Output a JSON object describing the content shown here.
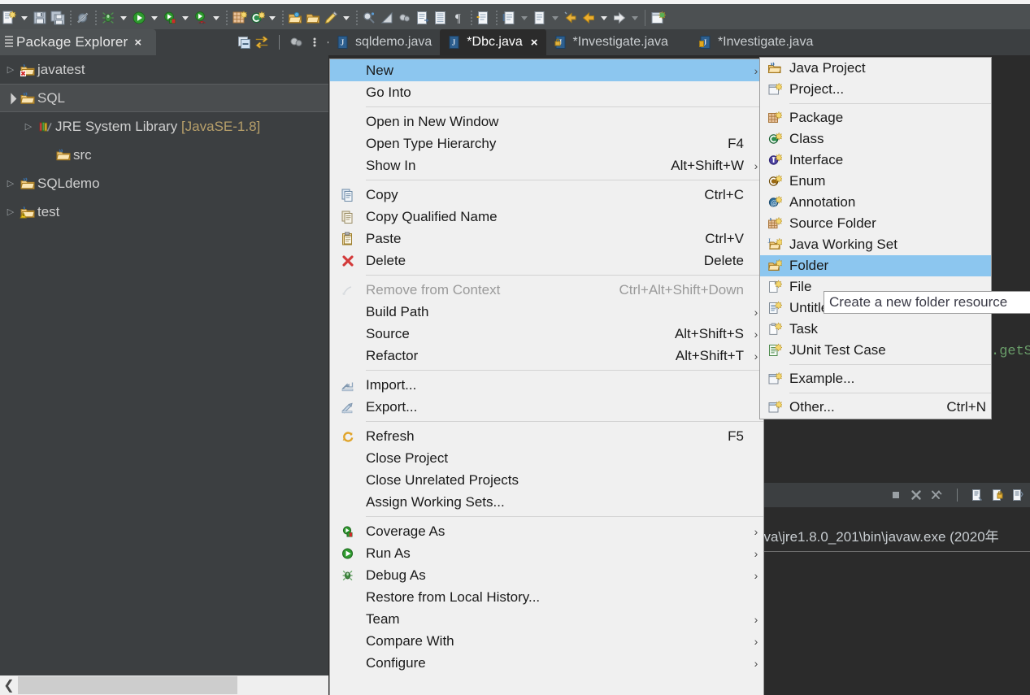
{
  "window": {
    "theme_background": "#3c3f41",
    "editor_background": "#2b2b2b",
    "menu_background": "#f0f0f0",
    "menu_highlight": "#8cc6ef"
  },
  "toolbar": {
    "items": [
      {
        "name": "new-wizard-icon",
        "type": "icon",
        "kind": "new-file"
      },
      {
        "name": "new-wizard-dropdown",
        "type": "arrow"
      },
      {
        "name": "save-icon",
        "type": "icon",
        "kind": "save"
      },
      {
        "name": "save-all-icon",
        "type": "icon",
        "kind": "save-all"
      },
      {
        "name": "toolbar-separator",
        "type": "sep"
      },
      {
        "name": "skip-all-breakpoints-icon",
        "type": "icon",
        "kind": "skip-breakpoints"
      },
      {
        "name": "toolbar-separator",
        "type": "sep"
      },
      {
        "name": "debug-icon",
        "type": "icon",
        "kind": "debug"
      },
      {
        "name": "debug-dropdown",
        "type": "arrow"
      },
      {
        "name": "run-icon",
        "type": "icon",
        "kind": "run"
      },
      {
        "name": "run-dropdown",
        "type": "arrow"
      },
      {
        "name": "coverage-icon",
        "type": "icon",
        "kind": "coverage"
      },
      {
        "name": "coverage-dropdown",
        "type": "arrow"
      },
      {
        "name": "profile-icon",
        "type": "icon",
        "kind": "profile"
      },
      {
        "name": "profile-dropdown",
        "type": "arrow"
      },
      {
        "name": "toolbar-separator",
        "type": "sep"
      },
      {
        "name": "new-package-icon",
        "type": "icon",
        "kind": "package"
      },
      {
        "name": "new-class-icon",
        "type": "icon",
        "kind": "class"
      },
      {
        "name": "new-class-dropdown",
        "type": "arrow"
      },
      {
        "name": "toolbar-separator",
        "type": "sep"
      },
      {
        "name": "open-type-icon",
        "type": "icon",
        "kind": "open-type"
      },
      {
        "name": "open-task-icon",
        "type": "icon",
        "kind": "open-folder"
      },
      {
        "name": "highlight-icon",
        "type": "icon",
        "kind": "pencil"
      },
      {
        "name": "highlight-dropdown",
        "type": "arrow"
      },
      {
        "name": "toolbar-separator",
        "type": "sep"
      },
      {
        "name": "search-icon",
        "type": "icon",
        "kind": "search"
      },
      {
        "name": "ruler-icon",
        "type": "icon",
        "kind": "ruler"
      },
      {
        "name": "link-icon",
        "type": "icon",
        "kind": "link"
      },
      {
        "name": "next-annotation-icon",
        "type": "icon",
        "kind": "annot1"
      },
      {
        "name": "prev-annotation-icon",
        "type": "icon",
        "kind": "annot2"
      },
      {
        "name": "show-whitespace-icon",
        "type": "icon",
        "kind": "pilcrow"
      },
      {
        "name": "toolbar-separator",
        "type": "sep"
      },
      {
        "name": "next-edit-icon",
        "type": "icon",
        "kind": "edit1"
      },
      {
        "name": "toolbar-separator",
        "type": "sep"
      },
      {
        "name": "prev-member-icon",
        "type": "icon",
        "kind": "member1"
      },
      {
        "name": "prev-member-dropdown",
        "type": "arrow",
        "dim": true
      },
      {
        "name": "next-member-icon",
        "type": "icon",
        "kind": "member2"
      },
      {
        "name": "next-member-dropdown",
        "type": "arrow",
        "dim": true
      },
      {
        "name": "back-history-icon",
        "type": "icon",
        "kind": "back-sm"
      },
      {
        "name": "back-icon",
        "type": "icon",
        "kind": "back"
      },
      {
        "name": "back-dropdown",
        "type": "arrow"
      },
      {
        "name": "forward-icon",
        "type": "icon",
        "kind": "forward"
      },
      {
        "name": "forward-dropdown",
        "type": "arrow",
        "dim": true
      },
      {
        "name": "toolbar-separator",
        "type": "sepsolid"
      },
      {
        "name": "new-java-project-icon",
        "type": "icon",
        "kind": "new-proj"
      }
    ]
  },
  "package_explorer": {
    "tab_title": "Package Explorer",
    "close_label": "×",
    "view_tools": [
      "collapse-all-icon",
      "link-with-editor-icon",
      "view-menu-icon",
      "minimize-icon",
      "maximize-icon"
    ],
    "tree": [
      {
        "label": "javatest",
        "indent": 0,
        "arrow": "collapsed",
        "icon": "java-project-error",
        "selected": false
      },
      {
        "label": "SQL",
        "indent": 0,
        "arrow": "expanded",
        "icon": "java-project",
        "selected": true
      },
      {
        "label": "JRE System Library ",
        "suffix": "[JavaSE-1.8]",
        "indent": 1,
        "arrow": "collapsed",
        "icon": "library",
        "selected": false
      },
      {
        "label": "src",
        "indent": 2,
        "arrow": "none",
        "icon": "source-folder",
        "selected": false
      },
      {
        "label": "SQLdemo",
        "indent": 0,
        "arrow": "collapsed",
        "icon": "java-project",
        "selected": false
      },
      {
        "label": "test",
        "indent": 0,
        "arrow": "collapsed",
        "icon": "java-project-warn",
        "selected": false
      }
    ]
  },
  "editor_tabs": [
    {
      "label": "sqldemo.java",
      "active": false,
      "dirty": false,
      "icon": "java-file",
      "closable": false
    },
    {
      "label": "*Dbc.java",
      "active": true,
      "dirty": true,
      "icon": "java-file",
      "closable": true
    },
    {
      "label": "*Investigate.java",
      "active": false,
      "dirty": true,
      "icon": "java-file-lock",
      "closable": false
    },
    {
      "label": "*Investigate.java",
      "active": false,
      "dirty": true,
      "icon": "java-file-alt",
      "closable": false
    }
  ],
  "editor": {
    "visible_code_fragment": ".getS"
  },
  "console": {
    "toolbar_icons": [
      "terminate-icon",
      "remove-launch-icon",
      "remove-all-terminated-icon",
      "open-console-icon",
      "pin-console-icon",
      "display-selected-console-icon"
    ],
    "line": "ava\\jre1.8.0_201\\bin\\javaw.exe (2020年"
  },
  "context_menu": {
    "items": [
      {
        "label": "New",
        "accel": "",
        "icon": "",
        "submenu": true,
        "selected": true,
        "disabled": false
      },
      {
        "label": "Go Into",
        "accel": "",
        "icon": "",
        "submenu": false,
        "selected": false,
        "disabled": false
      },
      {
        "sep": true
      },
      {
        "label": "Open in New Window",
        "accel": "",
        "icon": "",
        "submenu": false,
        "selected": false,
        "disabled": false
      },
      {
        "label": "Open Type Hierarchy",
        "accel": "F4",
        "icon": "",
        "submenu": false,
        "selected": false,
        "disabled": false
      },
      {
        "label": "Show In",
        "accel": "Alt+Shift+W",
        "icon": "",
        "submenu": true,
        "selected": false,
        "disabled": false
      },
      {
        "sep": true
      },
      {
        "label": "Copy",
        "accel": "Ctrl+C",
        "icon": "copy-icon",
        "submenu": false,
        "selected": false,
        "disabled": false
      },
      {
        "label": "Copy Qualified Name",
        "accel": "",
        "icon": "copy-qualified-icon",
        "submenu": false,
        "selected": false,
        "disabled": false
      },
      {
        "label": "Paste",
        "accel": "Ctrl+V",
        "icon": "paste-icon",
        "submenu": false,
        "selected": false,
        "disabled": false
      },
      {
        "label": "Delete",
        "accel": "Delete",
        "icon": "delete-icon",
        "submenu": false,
        "selected": false,
        "disabled": false
      },
      {
        "sep": true
      },
      {
        "label": "Remove from Context",
        "accel": "Ctrl+Alt+Shift+Down",
        "icon": "remove-context-icon",
        "submenu": false,
        "selected": false,
        "disabled": true
      },
      {
        "label": "Build Path",
        "accel": "",
        "icon": "",
        "submenu": true,
        "selected": false,
        "disabled": false
      },
      {
        "label": "Source",
        "accel": "Alt+Shift+S",
        "icon": "",
        "submenu": true,
        "selected": false,
        "disabled": false
      },
      {
        "label": "Refactor",
        "accel": "Alt+Shift+T",
        "icon": "",
        "submenu": true,
        "selected": false,
        "disabled": false
      },
      {
        "sep": true
      },
      {
        "label": "Import...",
        "accel": "",
        "icon": "import-icon",
        "submenu": false,
        "selected": false,
        "disabled": false
      },
      {
        "label": "Export...",
        "accel": "",
        "icon": "export-icon",
        "submenu": false,
        "selected": false,
        "disabled": false
      },
      {
        "sep": true
      },
      {
        "label": "Refresh",
        "accel": "F5",
        "icon": "refresh-icon",
        "submenu": false,
        "selected": false,
        "disabled": false
      },
      {
        "label": "Close Project",
        "accel": "",
        "icon": "",
        "submenu": false,
        "selected": false,
        "disabled": false
      },
      {
        "label": "Close Unrelated Projects",
        "accel": "",
        "icon": "",
        "submenu": false,
        "selected": false,
        "disabled": false
      },
      {
        "label": "Assign Working Sets...",
        "accel": "",
        "icon": "",
        "submenu": false,
        "selected": false,
        "disabled": false
      },
      {
        "sep": true
      },
      {
        "label": "Coverage As",
        "accel": "",
        "icon": "coverage-icon",
        "submenu": true,
        "selected": false,
        "disabled": false
      },
      {
        "label": "Run As",
        "accel": "",
        "icon": "run-icon",
        "submenu": true,
        "selected": false,
        "disabled": false
      },
      {
        "label": "Debug As",
        "accel": "",
        "icon": "debug-icon",
        "submenu": true,
        "selected": false,
        "disabled": false
      },
      {
        "label": "Restore from Local History...",
        "accel": "",
        "icon": "",
        "submenu": false,
        "selected": false,
        "disabled": false
      },
      {
        "label": "Team",
        "accel": "",
        "icon": "",
        "submenu": true,
        "selected": false,
        "disabled": false
      },
      {
        "label": "Compare With",
        "accel": "",
        "icon": "",
        "submenu": true,
        "selected": false,
        "disabled": false
      },
      {
        "label": "Configure",
        "accel": "",
        "icon": "",
        "submenu": true,
        "selected": false,
        "disabled": false
      }
    ]
  },
  "new_submenu": {
    "items": [
      {
        "label": "Java Project",
        "accel": "",
        "icon": "java-project-new-icon",
        "selected": false
      },
      {
        "label": "Project...",
        "accel": "",
        "icon": "project-new-icon",
        "selected": false
      },
      {
        "sep": true
      },
      {
        "label": "Package",
        "accel": "",
        "icon": "package-new-icon",
        "selected": false
      },
      {
        "label": "Class",
        "accel": "",
        "icon": "class-new-icon",
        "selected": false
      },
      {
        "label": "Interface",
        "accel": "",
        "icon": "interface-new-icon",
        "selected": false
      },
      {
        "label": "Enum",
        "accel": "",
        "icon": "enum-new-icon",
        "selected": false
      },
      {
        "label": "Annotation",
        "accel": "",
        "icon": "annotation-new-icon",
        "selected": false
      },
      {
        "label": "Source Folder",
        "accel": "",
        "icon": "source-folder-new-icon",
        "selected": false
      },
      {
        "label": "Java Working Set",
        "accel": "",
        "icon": "working-set-new-icon",
        "selected": false
      },
      {
        "label": "Folder",
        "accel": "",
        "icon": "folder-new-icon",
        "selected": true
      },
      {
        "label": "File",
        "accel": "",
        "icon": "file-new-icon",
        "selected": false
      },
      {
        "label": "Untitled Text File",
        "accel": "",
        "icon": "text-file-new-icon",
        "selected": false
      },
      {
        "label": "Task",
        "accel": "",
        "icon": "task-new-icon",
        "selected": false
      },
      {
        "label": "JUnit Test Case",
        "accel": "",
        "icon": "junit-new-icon",
        "selected": false
      },
      {
        "sep": true
      },
      {
        "label": "Example...",
        "accel": "",
        "icon": "example-new-icon",
        "selected": false
      },
      {
        "sep": true
      },
      {
        "label": "Other...",
        "accel": "Ctrl+N",
        "icon": "other-new-icon",
        "selected": false
      }
    ]
  },
  "tooltip": {
    "text": "Create a new folder resource"
  }
}
